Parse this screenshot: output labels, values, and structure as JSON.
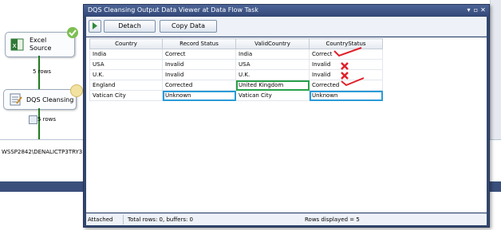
{
  "designer": {
    "excel_source": {
      "line1": "Excel",
      "line2": "Source"
    },
    "rows_label_1": "5 rows",
    "dqs_task": {
      "label": "DQS Cleansing"
    },
    "rows_label_2": "5 rows",
    "connection_text": "WSSP2842\\DENALICTP3TRY3"
  },
  "viewer": {
    "title": "DQS Cleansing Output Data Viewer at Data Flow Task",
    "window_buttons": {
      "dropdown": "▾",
      "pin": "▫",
      "close": "✕"
    },
    "toolbar": {
      "detach_label": "Detach",
      "copy_label": "Copy Data"
    },
    "columns": [
      "Country",
      "Record Status",
      "ValidCountry",
      "CountryStatus"
    ],
    "rows": [
      [
        "India",
        "Correct",
        "India",
        "Correct"
      ],
      [
        "USA",
        "Invalid",
        "USA",
        "Invalid"
      ],
      [
        "U.K.",
        "Invalid",
        "U.K.",
        "Invalid"
      ],
      [
        "England",
        "Corrected",
        "United Kingdom",
        "Corrected"
      ],
      [
        "Vatican City",
        "Unknown",
        "Vatican City",
        "Unknown"
      ]
    ],
    "status": {
      "attached": "Attached",
      "totals": "Total rows: 0, buffers: 0",
      "displayed": "Rows displayed = 5"
    }
  },
  "colors": {
    "highlight_green": "#2aa14a",
    "highlight_blue": "#2a9bd8",
    "annotation_red": "#e0202a",
    "window_frame": "#33476e"
  }
}
